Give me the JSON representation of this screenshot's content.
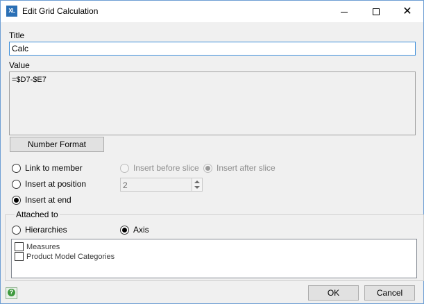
{
  "window": {
    "app_icon_text": "XL",
    "title": "Edit Grid Calculation",
    "close_glyph": "✕"
  },
  "form": {
    "title_label": "Title",
    "title_value": "Calc",
    "value_label": "Value",
    "value_text": "=$D7-$E7",
    "number_format_label": "Number Format"
  },
  "placement": {
    "link_to_member": "Link to member",
    "insert_at_position": "Insert at position",
    "insert_at_end": "Insert at end",
    "insert_before_slice": "Insert before slice",
    "insert_after_slice": "Insert after slice",
    "position_value": "2"
  },
  "attached": {
    "label": "Attached to",
    "hierarchies": "Hierarchies",
    "axis": "Axis",
    "items": [
      "Measures",
      "Product Model Categories"
    ]
  },
  "footer": {
    "ok_label": "OK",
    "cancel_label": "Cancel"
  },
  "colors": {
    "accent": "#3c8dd9",
    "window_border": "#6d9ed4",
    "help_icon": "#3d9a3d"
  }
}
